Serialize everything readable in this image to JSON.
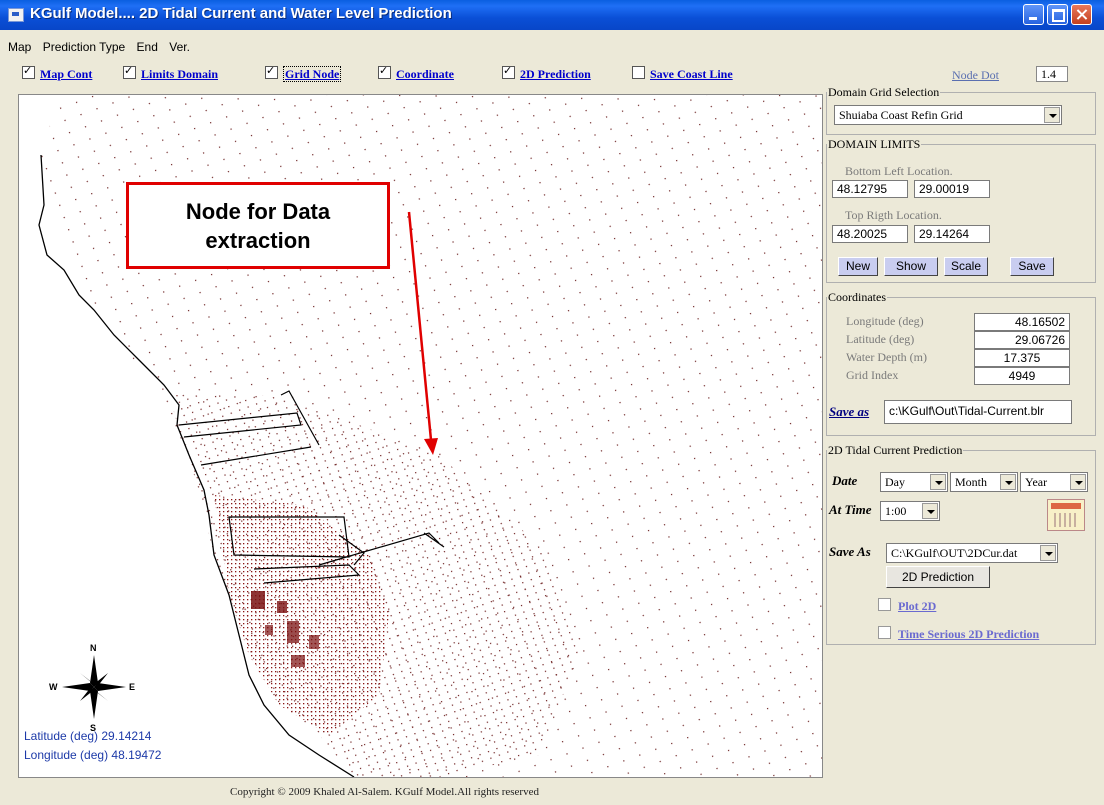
{
  "window": {
    "title": "KGulf Model.... 2D Tidal Current and Water Level Prediction"
  },
  "menu": [
    "Map",
    "Prediction Type",
    "End",
    "Ver."
  ],
  "options": [
    {
      "label": "Map Cont",
      "checked": true
    },
    {
      "label": "Limits Domain",
      "checked": true
    },
    {
      "label": "Grid Node",
      "checked": true
    },
    {
      "label": "Coordinate",
      "checked": true
    },
    {
      "label": "2D Prediction",
      "checked": true
    },
    {
      "label": "Save Coast Line",
      "checked": false
    }
  ],
  "node_dot": {
    "label": "Node Dot",
    "value": "1.4"
  },
  "domain_grid": {
    "legend": "Domain Grid Selection",
    "selected": "Shuiaba Coast Refin Grid"
  },
  "domain_limits": {
    "legend": "DOMAIN LIMITS",
    "bottom_left_label": "Bottom Left Location.",
    "bl_lon": "48.12795",
    "bl_lat": "29.00019",
    "top_right_label": "Top Rigth Location.",
    "tr_lon": "48.20025",
    "tr_lat": "29.14264",
    "buttons": {
      "new": "New",
      "show": "Show",
      "scale": "Scale",
      "save": "Save"
    }
  },
  "coordinates": {
    "legend": "Coordinates",
    "longitude_label": "Longitude (deg)",
    "longitude": "48.16502",
    "latitude_label": "Latitude (deg)",
    "latitude": "29.06726",
    "depth_label": "Water Depth (m)",
    "depth": "17.375",
    "grid_label": "Grid Index",
    "grid_index": "4949",
    "save_as_label": "Save as",
    "save_path": "c:\\KGulf\\Out\\Tidal-Current.blr"
  },
  "prediction": {
    "legend": "2D Tidal Current Prediction",
    "date_label": "Date",
    "day": "Day",
    "month": "Month",
    "year": "Year",
    "time_label": "At Time",
    "time": "1:00",
    "save_as_label": "Save As",
    "save_path": "C:\\KGulf\\OUT\\2DCur.dat",
    "predict_button": "2D Prediction",
    "plot_label": "Plot 2D",
    "series_label": "Time Serious 2D Prediction"
  },
  "map": {
    "compass": {
      "n": "N",
      "s": "S",
      "e": "E",
      "w": "W"
    },
    "lat_readout": "Latitude (deg)  29.14214",
    "lon_readout": "Longitude (deg)  48.19472",
    "callout_line1": "Node for Data",
    "callout_line2": "extraction"
  },
  "footer": {
    "copyright": "Copyright © 2009 Khaled Al-Salem. KGulf Model.All rights reserved"
  },
  "colors": {
    "titlebar": "#0a4fd6",
    "node_dark": "#7a1010",
    "callout_red": "#e00000",
    "link_blue": "#0000cc"
  }
}
